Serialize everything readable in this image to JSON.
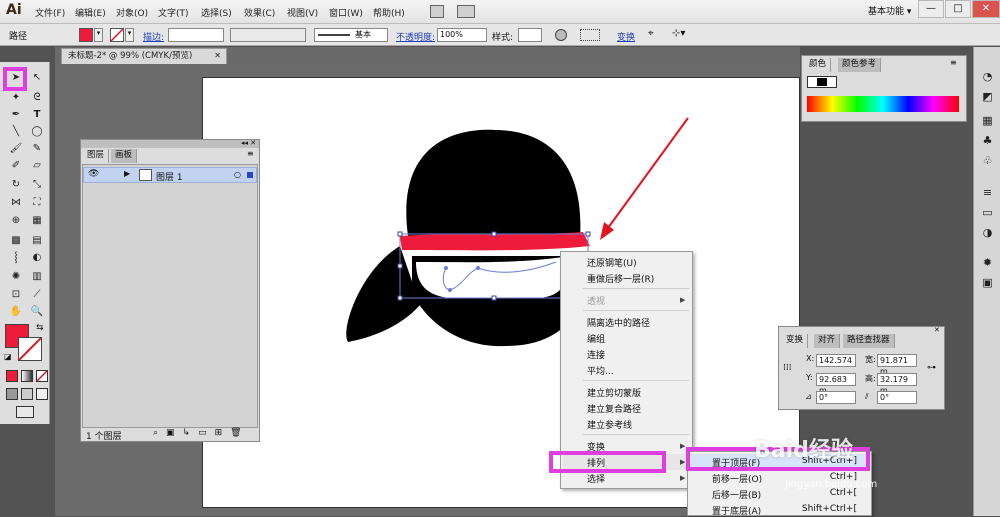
{
  "app": {
    "logo": "Ai"
  },
  "menubar": {
    "items": [
      "文件(F)",
      "编辑(E)",
      "对象(O)",
      "文字(T)",
      "选择(S)",
      "效果(C)",
      "视图(V)",
      "窗口(W)",
      "帮助(H)"
    ],
    "workspace": "基本功能",
    "workspace_arrow": "▾",
    "minimize": "—",
    "maximize": "□",
    "close": "✕"
  },
  "controlbar": {
    "selection_type": "路径",
    "stroke_label": "描边:",
    "brush_label": "基本",
    "opacity_label": "不透明度:",
    "opacity_value": "100%",
    "style_label": "样式:",
    "transform_label": "变换"
  },
  "document": {
    "tab_title": "未标题-2* @ 99% (CMYK/预览)",
    "close": "✕"
  },
  "layers_panel": {
    "tabs": [
      "图层",
      "画板"
    ],
    "layer_name": "图层 1",
    "footer": "1 个图层"
  },
  "color_panel": {
    "tabs": [
      "颜色",
      "颜色参考"
    ]
  },
  "transform_panel": {
    "tabs": [
      "变换",
      "对齐",
      "路径查找器"
    ],
    "x_label": "X:",
    "x_value": "142.574",
    "y_label": "Y:",
    "y_value": "92.683 m",
    "w_label": "宽:",
    "w_value": "91.871 m",
    "h_label": "高:",
    "h_value": "32.179 m",
    "rotate_value": "0°",
    "shear_value": "0°"
  },
  "context_menu": {
    "items": [
      {
        "label": "还原钢笔(U)",
        "disabled": false
      },
      {
        "label": "重做后移一层(R)",
        "disabled": false
      },
      {
        "label": "透视",
        "disabled": true,
        "submenu": true
      },
      {
        "label": "隔离选中的路径",
        "disabled": false
      },
      {
        "label": "编组",
        "disabled": false
      },
      {
        "label": "连接",
        "disabled": false
      },
      {
        "label": "平均...",
        "disabled": false
      },
      {
        "label": "建立剪切蒙版",
        "disabled": false
      },
      {
        "label": "建立复合路径",
        "disabled": false
      },
      {
        "label": "建立参考线",
        "disabled": false
      },
      {
        "label": "变换",
        "disabled": false,
        "submenu": true
      },
      {
        "label": "排列",
        "disabled": false,
        "submenu": true
      },
      {
        "label": "选择",
        "disabled": false,
        "submenu": true
      }
    ]
  },
  "arrange_submenu": {
    "items": [
      {
        "label": "置于顶层(F)",
        "shortcut": "Shift+Ctrl+]"
      },
      {
        "label": "前移一层(O)",
        "shortcut": "Ctrl+]"
      },
      {
        "label": "后移一层(B)",
        "shortcut": "Ctrl+["
      },
      {
        "label": "置于底层(A)",
        "shortcut": "Shift+Ctrl+["
      }
    ]
  },
  "watermark": {
    "main": "Baid经验",
    "sub": "jingyan.baidu.com"
  },
  "colors": {
    "fill_red": "#ee1c3a",
    "highlight_magenta": "#e13ee0",
    "annotation_red": "#e0141e"
  }
}
